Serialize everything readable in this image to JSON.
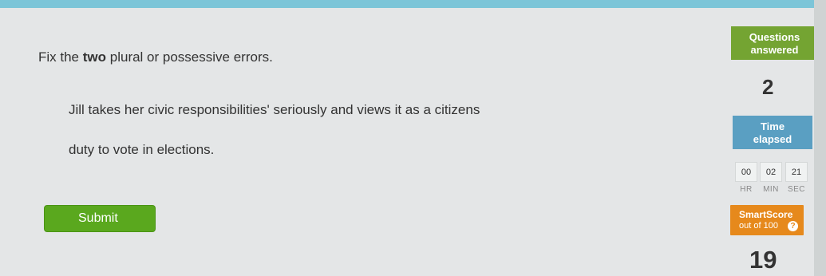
{
  "instruction": {
    "prefix": "Fix the ",
    "bold": "two",
    "suffix": " plural or possessive errors."
  },
  "sentence": {
    "line1": "Jill takes her civic responsibilities' seriously and views it as a citizens",
    "line2": "duty to vote in elections."
  },
  "submit_label": "Submit",
  "stats": {
    "questions_label_1": "Questions",
    "questions_label_2": "answered",
    "questions_value": "2",
    "time_label_1": "Time",
    "time_label_2": "elapsed",
    "time": {
      "hr": "00",
      "min": "02",
      "sec": "21"
    },
    "time_units": {
      "hr": "HR",
      "min": "MIN",
      "sec": "SEC"
    },
    "smartscore_label": "SmartScore",
    "smartscore_sub": "out of 100",
    "smartscore_value": "19",
    "help_icon": "?"
  },
  "colors": {
    "questions_box": "#74a432",
    "time_box": "#5a9fc2",
    "smartscore_box": "#e6891c",
    "submit_button": "#5aa81e"
  }
}
